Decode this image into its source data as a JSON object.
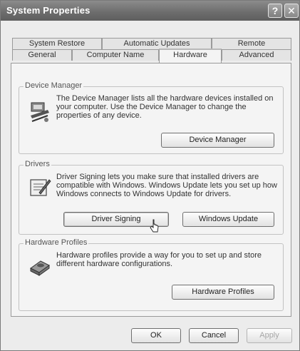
{
  "window": {
    "title": "System Properties",
    "help_label": "?",
    "close_label": "✕"
  },
  "tabs": {
    "row1": [
      {
        "label": "System Restore"
      },
      {
        "label": "Automatic Updates"
      },
      {
        "label": "Remote"
      }
    ],
    "row2": [
      {
        "label": "General"
      },
      {
        "label": "Computer Name"
      },
      {
        "label": "Hardware",
        "active": true
      },
      {
        "label": "Advanced"
      }
    ]
  },
  "device_manager": {
    "legend": "Device Manager",
    "description": "The Device Manager lists all the hardware devices installed on your computer. Use the Device Manager to change the properties of any device.",
    "button_label": "Device Manager",
    "icon": "device-manager-icon"
  },
  "drivers": {
    "legend": "Drivers",
    "description": "Driver Signing lets you make sure that installed drivers are compatible with Windows. Windows Update lets you set up how Windows connects to Windows Update for drivers.",
    "signing_button_label": "Driver Signing",
    "update_button_label": "Windows Update",
    "icon": "driver-signing-icon"
  },
  "hardware_profiles": {
    "legend": "Hardware Profiles",
    "description": "Hardware profiles provide a way for you to set up and store different hardware configurations.",
    "button_label": "Hardware Profiles",
    "icon": "hardware-profiles-icon"
  },
  "footer": {
    "ok_label": "OK",
    "cancel_label": "Cancel",
    "apply_label": "Apply"
  }
}
